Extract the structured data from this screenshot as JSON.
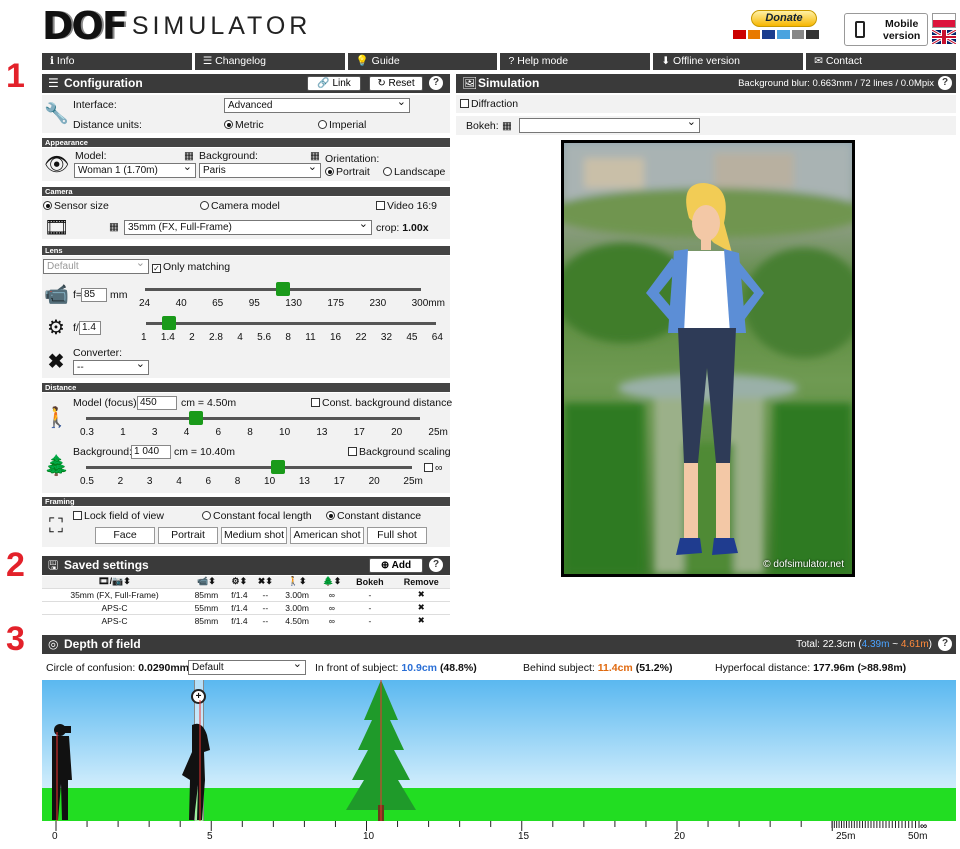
{
  "annotations": [
    "1",
    "2",
    "3"
  ],
  "logo": {
    "dof": "DOF",
    "simulator": "SIMULATOR"
  },
  "header": {
    "donate": "Donate",
    "mobile_line1": "Mobile",
    "mobile_line2": "version"
  },
  "nav": [
    {
      "icon": "ℹ",
      "label": "Info"
    },
    {
      "icon": "☰",
      "label": "Changelog"
    },
    {
      "icon": "💡",
      "label": "Guide"
    },
    {
      "icon": "?",
      "label": "Help mode"
    },
    {
      "icon": "⬇",
      "label": "Offline version"
    },
    {
      "icon": "✉",
      "label": "Contact"
    }
  ],
  "config": {
    "title": "Configuration",
    "link": "Link",
    "reset": "Reset",
    "interface_label": "Interface:",
    "interface_value": "Advanced",
    "units_label": "Distance units:",
    "metric": "Metric",
    "imperial": "Imperial",
    "appearance": "Appearance",
    "model_label": "Model:",
    "model_value": "Woman 1 (1.70m)",
    "background_label": "Background:",
    "background_value": "Paris",
    "orientation_label": "Orientation:",
    "portrait": "Portrait",
    "landscape": "Landscape",
    "camera": "Camera",
    "sensor_size": "Sensor size",
    "camera_model": "Camera model",
    "video": "Video 16:9",
    "sensor_value": "35mm (FX, Full-Frame)",
    "crop_label": "crop:",
    "crop_value": "1.00x",
    "lens": "Lens",
    "lens_value": "Default",
    "only_matching": "Only matching",
    "focal_prefix": "f=",
    "focal_value": "85",
    "focal_unit": "mm",
    "focal_level": 0.5,
    "focal_ticks": [
      "24",
      "40",
      "65",
      "95",
      "130",
      "175",
      "230",
      "300mm"
    ],
    "aperture_prefix": "f/",
    "aperture_value": "1.4",
    "aperture_level": 0.08,
    "aperture_ticks": [
      "1",
      "1.4",
      "2",
      "2.8",
      "4",
      "5.6",
      "8",
      "11",
      "16",
      "22",
      "32",
      "45",
      "64"
    ],
    "converter_label": "Converter:",
    "converter_value": "--",
    "distance": "Distance",
    "model_focus_label": "Model (focus):",
    "model_focus_value": "450",
    "model_focus_result": "cm = 4.50m",
    "const_bg": "Const. background distance",
    "model_level": 0.33,
    "model_ticks": [
      "0.3",
      "1",
      "3",
      "4",
      "6",
      "8",
      "10",
      "13",
      "17",
      "20",
      "25m"
    ],
    "background_dist_label": "Background:",
    "background_dist_value": "1 040",
    "background_dist_result": "cm = 10.40m",
    "bg_scaling": "Background scaling",
    "bg_level": 0.59,
    "bg_ticks": [
      "0.5",
      "2",
      "3",
      "4",
      "6",
      "8",
      "10",
      "13",
      "17",
      "20",
      "25m"
    ],
    "inf_symbol": "∞",
    "framing": "Framing",
    "lock_fov": "Lock field of view",
    "const_focal": "Constant focal length",
    "const_distance": "Constant distance",
    "framing_buttons": [
      "Face",
      "Portrait",
      "Medium shot",
      "American shot",
      "Full shot"
    ]
  },
  "saved": {
    "title": "Saved settings",
    "add": "Add",
    "headers": [
      "",
      "",
      "",
      "",
      "",
      "",
      "Bokeh",
      "Remove"
    ],
    "rows": [
      [
        "35mm (FX, Full-Frame)",
        "85mm",
        "f/1.4",
        "--",
        "3.00m",
        "∞",
        "-",
        "✖"
      ],
      [
        "APS-C",
        "55mm",
        "f/1.4",
        "--",
        "3.00m",
        "∞",
        "-",
        "✖"
      ],
      [
        "APS-C",
        "85mm",
        "f/1.4",
        "--",
        "4.50m",
        "∞",
        "-",
        "✖"
      ]
    ]
  },
  "simulation": {
    "title": "Simulation",
    "blur_info": "Background blur: 0.663mm / 72 lines / 0.0Mpix",
    "diffraction": "Diffraction",
    "bokeh_label": "Bokeh:",
    "bokeh_value": "",
    "watermark": "© dofsimulator.net"
  },
  "dof": {
    "title": "Depth of field",
    "total_label": "Total:",
    "total_value": "22.3cm",
    "near": "4.39m",
    "tilde": "~",
    "far": "4.61m",
    "coc_label": "Circle of confusion:",
    "coc_value": "0.0290mm",
    "coc_select": "Default",
    "front_label": "In front of subject:",
    "front_value": "10.9cm",
    "front_pct": "(48.8%)",
    "behind_label": "Behind subject:",
    "behind_value": "11.4cm",
    "behind_pct": "(51.2%)",
    "hyper_label": "Hyperfocal distance:",
    "hyper_value": "177.96m",
    "hyper_extra": "(>88.98m)",
    "ruler_labels": [
      "0",
      "5",
      "10",
      "15",
      "20",
      "25m",
      "50m",
      "∞"
    ]
  },
  "colors": {
    "header_bg": "#3a3a3a",
    "slider": "#1a9a1a",
    "near": "#2a6fd6",
    "far": "#e06a10",
    "annotation": "#e3212a",
    "grass": "#22dd22"
  }
}
